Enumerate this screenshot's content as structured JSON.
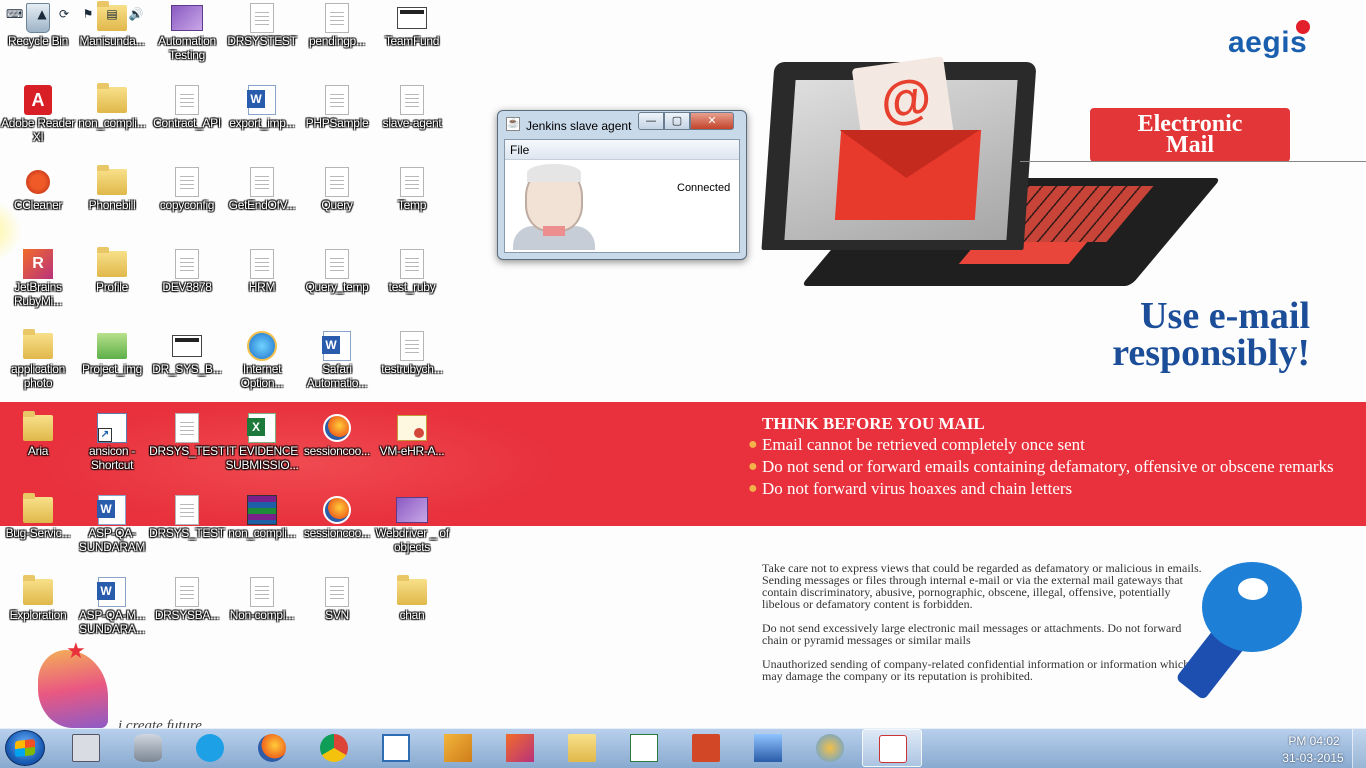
{
  "desktop_icons": [
    {
      "label": "Recycle Bin",
      "icon": "recycle-bin-icon"
    },
    {
      "label": "Manisunda...",
      "icon": "folder-icon"
    },
    {
      "label": "Automation Testing",
      "icon": "image-file-icon"
    },
    {
      "label": "DRSYSTEST",
      "icon": "blank-file-icon"
    },
    {
      "label": "pendingp...",
      "icon": "document-icon"
    },
    {
      "label": "TeamFund",
      "icon": "application-icon"
    },
    {
      "label": "Adobe Reader XI",
      "icon": "adobe-reader-icon"
    },
    {
      "label": "non_compli...",
      "icon": "folder-icon"
    },
    {
      "label": "Contract_API",
      "icon": "document-icon"
    },
    {
      "label": "export_imp...",
      "icon": "word-document-icon"
    },
    {
      "label": "PHPSample",
      "icon": "document-icon"
    },
    {
      "label": "slave-agent",
      "icon": "jnlp-file-icon"
    },
    {
      "label": "CCleaner",
      "icon": "ccleaner-icon"
    },
    {
      "label": "Phonebill",
      "icon": "folder-icon"
    },
    {
      "label": "copyconfig",
      "icon": "document-icon"
    },
    {
      "label": "GetEndOfV...",
      "icon": "document-icon"
    },
    {
      "label": "Query",
      "icon": "document-icon"
    },
    {
      "label": "Temp",
      "icon": "document-icon"
    },
    {
      "label": "JetBrains RubyMi...",
      "icon": "rubymine-icon"
    },
    {
      "label": "Profile",
      "icon": "folder-icon"
    },
    {
      "label": "DEV3878",
      "icon": "document-icon"
    },
    {
      "label": "HRM",
      "icon": "document-icon"
    },
    {
      "label": "Query_temp",
      "icon": "document-icon"
    },
    {
      "label": "test_ruby",
      "icon": "document-icon"
    },
    {
      "label": "application photo",
      "icon": "folder-icon"
    },
    {
      "label": "Project_img",
      "icon": "image-folder-icon"
    },
    {
      "label": "DR_SYS_B...",
      "icon": "application-icon"
    },
    {
      "label": "Internet Option...",
      "icon": "internet-options-icon"
    },
    {
      "label": "Safari Automatio...",
      "icon": "word-document-icon"
    },
    {
      "label": "testrubych...",
      "icon": "document-icon"
    },
    {
      "label": "Aria",
      "icon": "folder-icon"
    },
    {
      "label": "ansicon - Shortcut",
      "icon": "shortcut-icon"
    },
    {
      "label": "DRSYS_TEST",
      "icon": "document-icon"
    },
    {
      "label": "IT EVIDENCE SUBMISSIO...",
      "icon": "excel-document-icon"
    },
    {
      "label": "sessioncoo...",
      "icon": "firefox-file-icon"
    },
    {
      "label": "VM-eHR-A...",
      "icon": "certificate-icon"
    },
    {
      "label": "Bug-Servic...",
      "icon": "folder-icon"
    },
    {
      "label": "ASP-QA-SUNDARAM",
      "icon": "word-document-icon"
    },
    {
      "label": "DRSYS_TEST",
      "icon": "blank-file-icon"
    },
    {
      "label": "non_compli...",
      "icon": "winrar-archive-icon"
    },
    {
      "label": "sessioncoo...",
      "icon": "firefox-file-icon"
    },
    {
      "label": "Webdriver _ of objects",
      "icon": "image-file-icon"
    },
    {
      "label": "Exploration",
      "icon": "folder-icon"
    },
    {
      "label": "ASP-QA-M... SUNDARA...",
      "icon": "word-document-icon"
    },
    {
      "label": "DRSYSBA...",
      "icon": "document-icon"
    },
    {
      "label": "Non-compl...",
      "icon": "notepad-file-icon"
    },
    {
      "label": "SVN",
      "icon": "document-icon"
    },
    {
      "label": "chan",
      "icon": "folder-icon"
    }
  ],
  "jenkins_window": {
    "title": "Jenkins slave agent",
    "min_glyph": "—",
    "max_glyph": "▢",
    "close_glyph": "✕",
    "menu_file": "File",
    "status": "Connected"
  },
  "wallpaper": {
    "logo": "aegis",
    "badge_line1": "Electronic",
    "badge_line2": "Mail",
    "headline_line1": "Use e-mail",
    "headline_line2": "responsibly!",
    "think_title": "THINK BEFORE YOU MAIL",
    "think_items": [
      "Email cannot be retrieved completely once sent",
      "Do not send or forward emails containing defamatory, offensive or obscene remarks",
      "Do not forward virus hoaxes and chain letters"
    ],
    "policy_paragraphs": [
      "Take care not to express views that could be regarded as defamatory or malicious in emails. Sending messages or files through internal e-mail or via the external mail gateways that contain discriminatory, abusive, pornographic, obscene, illegal, offensive, potentially libelous or defamatory content is forbidden.",
      "Do not send excessively large electronic mail messages or attachments. Do not forward chain or pyramid messages or similar mails",
      "Unauthorized sending of company-related confidential information or information which may damage the company or its reputation is prohibited."
    ],
    "tagline": "i create future"
  },
  "taskbar": {
    "pinned": [
      {
        "name": "calculator",
        "icon": "calculator-icon",
        "active": false
      },
      {
        "name": "database-tool",
        "icon": "database-icon",
        "active": false
      },
      {
        "name": "skype",
        "icon": "skype-icon",
        "active": false
      },
      {
        "name": "firefox",
        "icon": "firefox-icon",
        "active": false
      },
      {
        "name": "chrome",
        "icon": "chrome-icon",
        "active": false
      },
      {
        "name": "remote-tool",
        "icon": "remote-desktop-icon",
        "active": false
      },
      {
        "name": "outlook",
        "icon": "outlook-icon",
        "active": false
      },
      {
        "name": "rubymine",
        "icon": "rubymine-icon",
        "active": false
      },
      {
        "name": "explorer",
        "icon": "windows-explorer-icon",
        "active": false
      },
      {
        "name": "project",
        "icon": "chart-file-icon",
        "active": false
      },
      {
        "name": "powerpoint",
        "icon": "powerpoint-icon",
        "active": false
      },
      {
        "name": "network",
        "icon": "network-computer-icon",
        "active": false
      },
      {
        "name": "paint",
        "icon": "paint-palette-icon",
        "active": false
      },
      {
        "name": "java",
        "icon": "java-icon",
        "active": true
      }
    ],
    "tray_icons": [
      "keyboard-icon",
      "tray-expand-icon",
      "green-sync-icon",
      "flag-alert-icon",
      "network-status-icon",
      "volume-icon"
    ],
    "clock_time": "PM 04:02",
    "clock_date": "31-03-2015"
  },
  "colors": {
    "wallpaper_band": "#e8313c",
    "headline_blue": "#1b4d99",
    "taskbar": "#9fbadb"
  }
}
